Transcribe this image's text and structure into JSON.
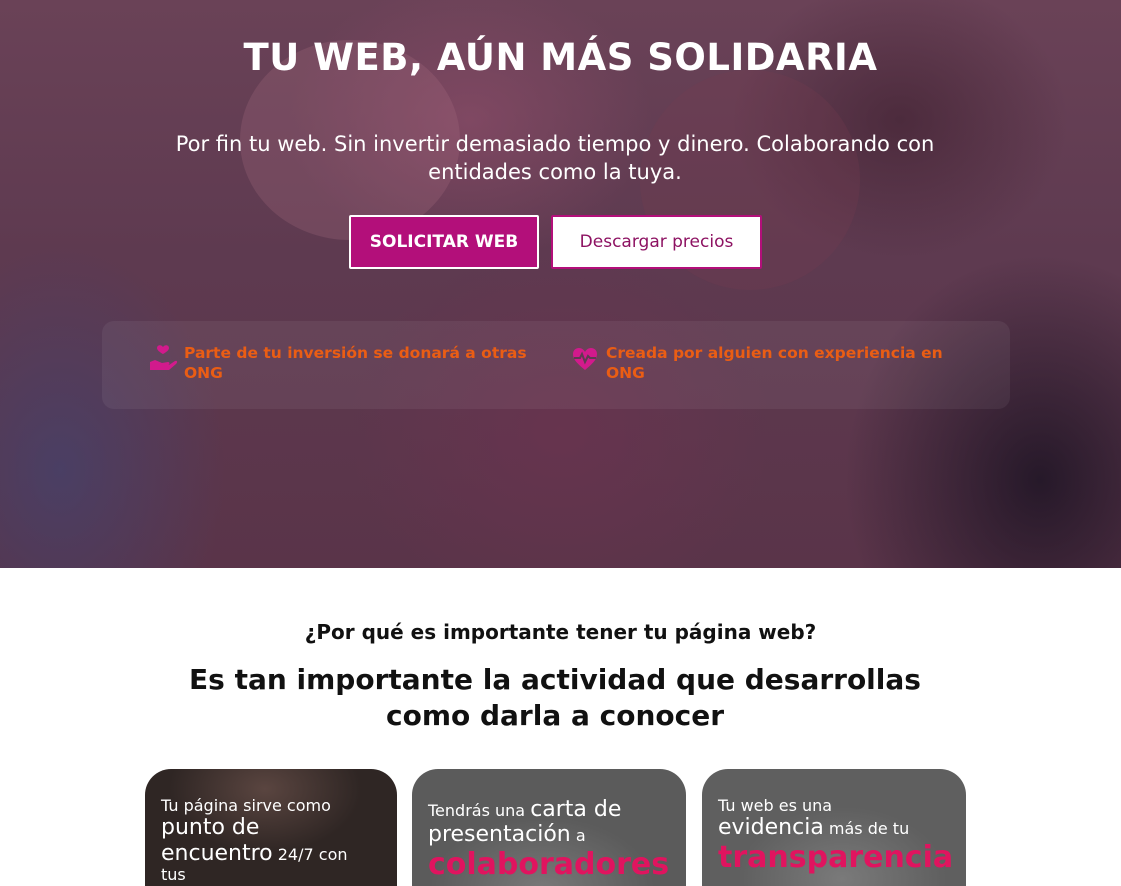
{
  "hero": {
    "title": "TU WEB, AÚN MÁS SOLIDARIA",
    "subtitle": "Por fin tu web. Sin invertir demasiado tiempo y dinero. Colaborando con entidades como la tuya.",
    "primary_button": "SOLICITAR WEB",
    "secondary_button": "Descargar precios",
    "features": [
      {
        "icon": "heart-hand-icon",
        "text": "Parte de tu inversión se donará a otras ONG"
      },
      {
        "icon": "heartbeat-icon",
        "text": "Creada por alguien con experiencia en ONG"
      }
    ]
  },
  "why": {
    "question": "¿Por qué es importante tener tu página web?",
    "heading": "Es tan importante la actividad que desarrollas como darla a conocer"
  },
  "cards": [
    {
      "line1": "Tu página sirve como",
      "line2": "punto de",
      "line3": "encuentro",
      "line3b": "24/7 con",
      "line4": "tus"
    },
    {
      "line1a": "Tendrás una",
      "line1b": "carta de",
      "line2a": "presentación",
      "line2b": "a",
      "line3": "colaboradores"
    },
    {
      "line1": "Tu web es una",
      "line2a": "evidencia",
      "line2b": "más de tu",
      "line3": "transparencia"
    }
  ],
  "colors": {
    "brand": "#b30f7a",
    "accent_orange": "#ea5d14",
    "accent_pink": "#e0145f"
  }
}
